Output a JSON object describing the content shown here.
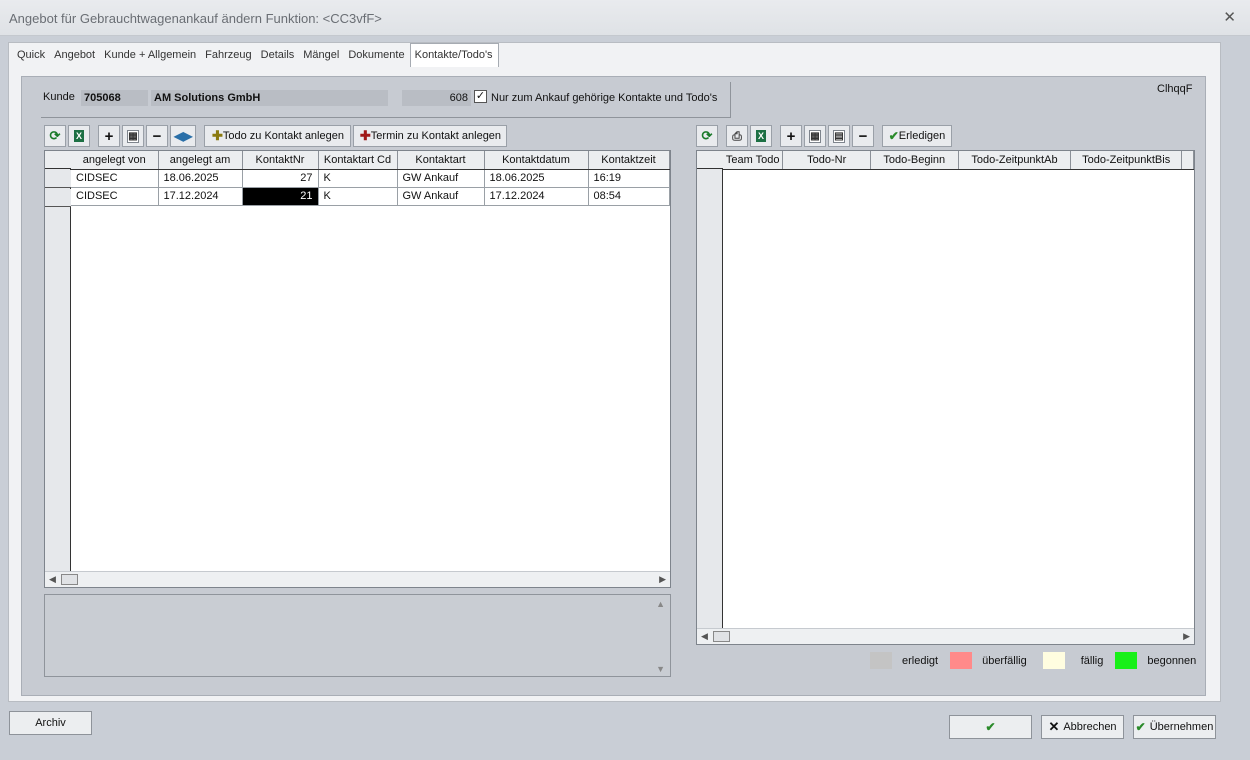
{
  "window": {
    "title": "Angebot für Gebrauchtwagenankauf ändern   Funktion: <CC3vfF>",
    "close_icon": "close-icon"
  },
  "tabs": [
    "Quick",
    "Angebot",
    "Kunde + Allgemein",
    "Fahrzeug",
    "Details",
    "Mängel",
    "Dokumente",
    "Kontakte/Todo's"
  ],
  "active_tab": "Kontakte/Todo's",
  "kunde": {
    "label": "Kunde",
    "number": "705068",
    "name": "AM Solutions GmbH",
    "count": "608",
    "only_ankauf_checked": true,
    "only_ankauf_label": "Nur zum Ankauf gehörige Kontakte und Todo's"
  },
  "code_label": "ClhqqF",
  "left_toolbar": {
    "todo_button": "Todo zu Kontakt anlegen",
    "termin_button": "Termin zu Kontakt anlegen"
  },
  "contacts_grid": {
    "columns": [
      "angelegt von",
      "angelegt am",
      "KontaktNr",
      "Kontaktart Cd",
      "Kontaktart",
      "Kontaktdatum",
      "Kontaktzeit"
    ],
    "rows": [
      [
        "CIDSEC",
        "18.06.2025",
        "27",
        "K",
        "GW Ankauf",
        "18.06.2025",
        "16:19"
      ],
      [
        "CIDSEC",
        "17.12.2024",
        "21",
        "K",
        "GW Ankauf",
        "17.12.2024",
        "08:54"
      ]
    ]
  },
  "right_toolbar": {
    "erledigen_button": "Erledigen"
  },
  "todo_grid": {
    "columns": [
      "Team Todo",
      "Todo-Nr",
      "Todo-Beginn",
      "Todo-ZeitpunktAb",
      "Todo-ZeitpunktBis"
    ],
    "rows": []
  },
  "legend": [
    {
      "label": "erledigt",
      "color": "#c4c4c4"
    },
    {
      "label": "überfällig",
      "color": "#ff8a8a"
    },
    {
      "label": "fällig",
      "color": "#fffde0"
    },
    {
      "label": "begonnen",
      "color": "#18f018"
    }
  ],
  "footer": {
    "archiv": "Archiv",
    "ok": "OK",
    "abbrechen": "Abbrechen",
    "uebernehmen": "Übernehmen"
  }
}
